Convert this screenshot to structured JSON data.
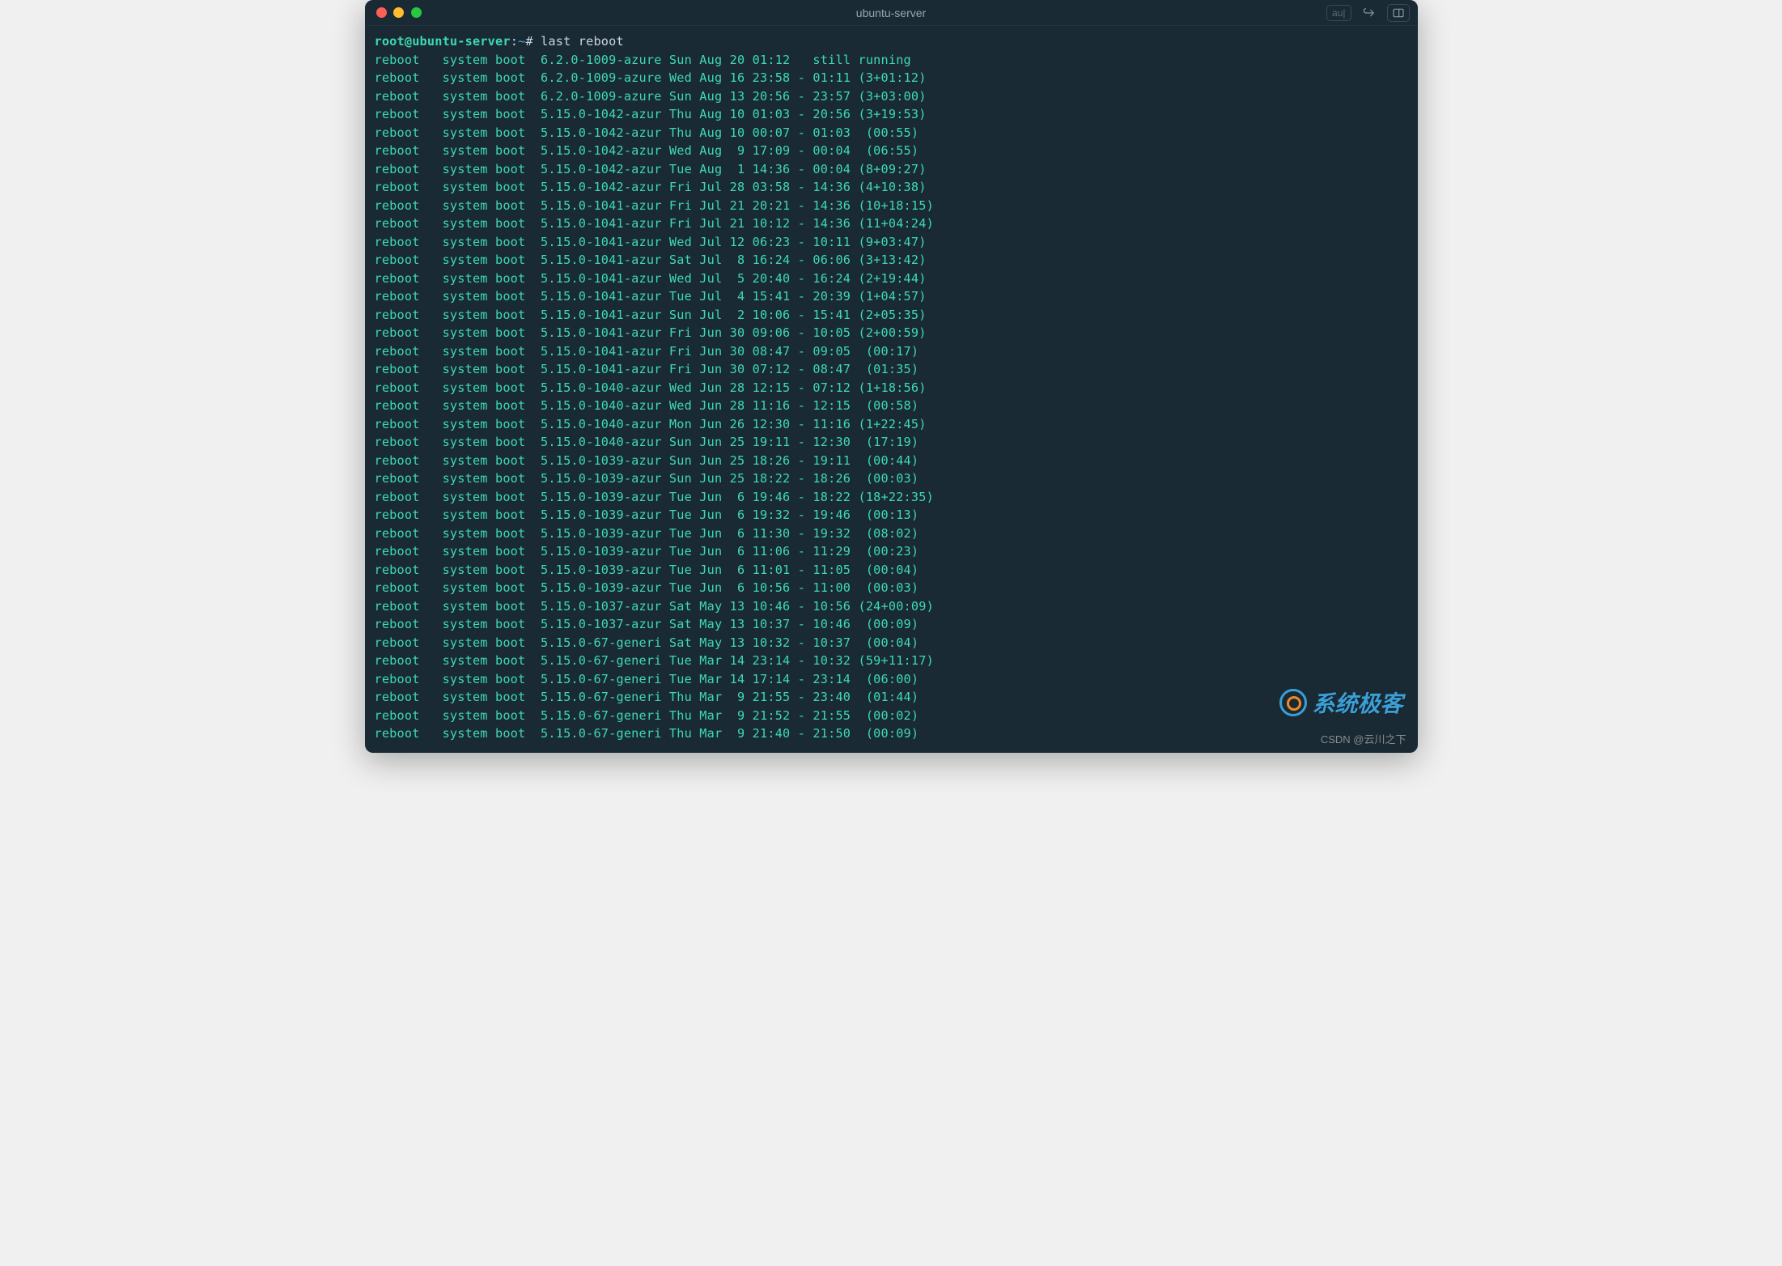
{
  "title": "ubuntu-server",
  "titlebar_au": "au|",
  "prompt": {
    "user_host": "root@ubuntu-server",
    "sep": ":",
    "path": "~",
    "hash": "#",
    "command": "last reboot"
  },
  "rows": [
    {
      "name": "reboot",
      "type": "system boot",
      "kernel": "6.2.0-1009-azure",
      "start": "Sun Aug 20 01:12",
      "end": "",
      "status": "still running",
      "duration": ""
    },
    {
      "name": "reboot",
      "type": "system boot",
      "kernel": "6.2.0-1009-azure",
      "start": "Wed Aug 16 23:58",
      "end": "01:11",
      "status": "",
      "duration": "(3+01:12)"
    },
    {
      "name": "reboot",
      "type": "system boot",
      "kernel": "6.2.0-1009-azure",
      "start": "Sun Aug 13 20:56",
      "end": "23:57",
      "status": "",
      "duration": "(3+03:00)"
    },
    {
      "name": "reboot",
      "type": "system boot",
      "kernel": "5.15.0-1042-azur",
      "start": "Thu Aug 10 01:03",
      "end": "20:56",
      "status": "",
      "duration": "(3+19:53)"
    },
    {
      "name": "reboot",
      "type": "system boot",
      "kernel": "5.15.0-1042-azur",
      "start": "Thu Aug 10 00:07",
      "end": "01:03",
      "status": "",
      "duration": " (00:55)"
    },
    {
      "name": "reboot",
      "type": "system boot",
      "kernel": "5.15.0-1042-azur",
      "start": "Wed Aug  9 17:09",
      "end": "00:04",
      "status": "",
      "duration": " (06:55)"
    },
    {
      "name": "reboot",
      "type": "system boot",
      "kernel": "5.15.0-1042-azur",
      "start": "Tue Aug  1 14:36",
      "end": "00:04",
      "status": "",
      "duration": "(8+09:27)"
    },
    {
      "name": "reboot",
      "type": "system boot",
      "kernel": "5.15.0-1042-azur",
      "start": "Fri Jul 28 03:58",
      "end": "14:36",
      "status": "",
      "duration": "(4+10:38)"
    },
    {
      "name": "reboot",
      "type": "system boot",
      "kernel": "5.15.0-1041-azur",
      "start": "Fri Jul 21 20:21",
      "end": "14:36",
      "status": "",
      "duration": "(10+18:15)"
    },
    {
      "name": "reboot",
      "type": "system boot",
      "kernel": "5.15.0-1041-azur",
      "start": "Fri Jul 21 10:12",
      "end": "14:36",
      "status": "",
      "duration": "(11+04:24)"
    },
    {
      "name": "reboot",
      "type": "system boot",
      "kernel": "5.15.0-1041-azur",
      "start": "Wed Jul 12 06:23",
      "end": "10:11",
      "status": "",
      "duration": "(9+03:47)"
    },
    {
      "name": "reboot",
      "type": "system boot",
      "kernel": "5.15.0-1041-azur",
      "start": "Sat Jul  8 16:24",
      "end": "06:06",
      "status": "",
      "duration": "(3+13:42)"
    },
    {
      "name": "reboot",
      "type": "system boot",
      "kernel": "5.15.0-1041-azur",
      "start": "Wed Jul  5 20:40",
      "end": "16:24",
      "status": "",
      "duration": "(2+19:44)"
    },
    {
      "name": "reboot",
      "type": "system boot",
      "kernel": "5.15.0-1041-azur",
      "start": "Tue Jul  4 15:41",
      "end": "20:39",
      "status": "",
      "duration": "(1+04:57)"
    },
    {
      "name": "reboot",
      "type": "system boot",
      "kernel": "5.15.0-1041-azur",
      "start": "Sun Jul  2 10:06",
      "end": "15:41",
      "status": "",
      "duration": "(2+05:35)"
    },
    {
      "name": "reboot",
      "type": "system boot",
      "kernel": "5.15.0-1041-azur",
      "start": "Fri Jun 30 09:06",
      "end": "10:05",
      "status": "",
      "duration": "(2+00:59)"
    },
    {
      "name": "reboot",
      "type": "system boot",
      "kernel": "5.15.0-1041-azur",
      "start": "Fri Jun 30 08:47",
      "end": "09:05",
      "status": "",
      "duration": " (00:17)"
    },
    {
      "name": "reboot",
      "type": "system boot",
      "kernel": "5.15.0-1041-azur",
      "start": "Fri Jun 30 07:12",
      "end": "08:47",
      "status": "",
      "duration": " (01:35)"
    },
    {
      "name": "reboot",
      "type": "system boot",
      "kernel": "5.15.0-1040-azur",
      "start": "Wed Jun 28 12:15",
      "end": "07:12",
      "status": "",
      "duration": "(1+18:56)"
    },
    {
      "name": "reboot",
      "type": "system boot",
      "kernel": "5.15.0-1040-azur",
      "start": "Wed Jun 28 11:16",
      "end": "12:15",
      "status": "",
      "duration": " (00:58)"
    },
    {
      "name": "reboot",
      "type": "system boot",
      "kernel": "5.15.0-1040-azur",
      "start": "Mon Jun 26 12:30",
      "end": "11:16",
      "status": "",
      "duration": "(1+22:45)"
    },
    {
      "name": "reboot",
      "type": "system boot",
      "kernel": "5.15.0-1040-azur",
      "start": "Sun Jun 25 19:11",
      "end": "12:30",
      "status": "",
      "duration": " (17:19)"
    },
    {
      "name": "reboot",
      "type": "system boot",
      "kernel": "5.15.0-1039-azur",
      "start": "Sun Jun 25 18:26",
      "end": "19:11",
      "status": "",
      "duration": " (00:44)"
    },
    {
      "name": "reboot",
      "type": "system boot",
      "kernel": "5.15.0-1039-azur",
      "start": "Sun Jun 25 18:22",
      "end": "18:26",
      "status": "",
      "duration": " (00:03)"
    },
    {
      "name": "reboot",
      "type": "system boot",
      "kernel": "5.15.0-1039-azur",
      "start": "Tue Jun  6 19:46",
      "end": "18:22",
      "status": "",
      "duration": "(18+22:35)"
    },
    {
      "name": "reboot",
      "type": "system boot",
      "kernel": "5.15.0-1039-azur",
      "start": "Tue Jun  6 19:32",
      "end": "19:46",
      "status": "",
      "duration": " (00:13)"
    },
    {
      "name": "reboot",
      "type": "system boot",
      "kernel": "5.15.0-1039-azur",
      "start": "Tue Jun  6 11:30",
      "end": "19:32",
      "status": "",
      "duration": " (08:02)"
    },
    {
      "name": "reboot",
      "type": "system boot",
      "kernel": "5.15.0-1039-azur",
      "start": "Tue Jun  6 11:06",
      "end": "11:29",
      "status": "",
      "duration": " (00:23)"
    },
    {
      "name": "reboot",
      "type": "system boot",
      "kernel": "5.15.0-1039-azur",
      "start": "Tue Jun  6 11:01",
      "end": "11:05",
      "status": "",
      "duration": " (00:04)"
    },
    {
      "name": "reboot",
      "type": "system boot",
      "kernel": "5.15.0-1039-azur",
      "start": "Tue Jun  6 10:56",
      "end": "11:00",
      "status": "",
      "duration": " (00:03)"
    },
    {
      "name": "reboot",
      "type": "system boot",
      "kernel": "5.15.0-1037-azur",
      "start": "Sat May 13 10:46",
      "end": "10:56",
      "status": "",
      "duration": "(24+00:09)"
    },
    {
      "name": "reboot",
      "type": "system boot",
      "kernel": "5.15.0-1037-azur",
      "start": "Sat May 13 10:37",
      "end": "10:46",
      "status": "",
      "duration": " (00:09)"
    },
    {
      "name": "reboot",
      "type": "system boot",
      "kernel": "5.15.0-67-generi",
      "start": "Sat May 13 10:32",
      "end": "10:37",
      "status": "",
      "duration": " (00:04)"
    },
    {
      "name": "reboot",
      "type": "system boot",
      "kernel": "5.15.0-67-generi",
      "start": "Tue Mar 14 23:14",
      "end": "10:32",
      "status": "",
      "duration": "(59+11:17)"
    },
    {
      "name": "reboot",
      "type": "system boot",
      "kernel": "5.15.0-67-generi",
      "start": "Tue Mar 14 17:14",
      "end": "23:14",
      "status": "",
      "duration": " (06:00)"
    },
    {
      "name": "reboot",
      "type": "system boot",
      "kernel": "5.15.0-67-generi",
      "start": "Thu Mar  9 21:55",
      "end": "23:40",
      "status": "",
      "duration": " (01:44)"
    },
    {
      "name": "reboot",
      "type": "system boot",
      "kernel": "5.15.0-67-generi",
      "start": "Thu Mar  9 21:52",
      "end": "21:55",
      "status": "",
      "duration": " (00:02)"
    },
    {
      "name": "reboot",
      "type": "system boot",
      "kernel": "5.15.0-67-generi",
      "start": "Thu Mar  9 21:40",
      "end": "21:50",
      "status": "",
      "duration": " (00:09)"
    }
  ],
  "watermark_text": "系统极客",
  "csdn_text": "CSDN @云川之下"
}
